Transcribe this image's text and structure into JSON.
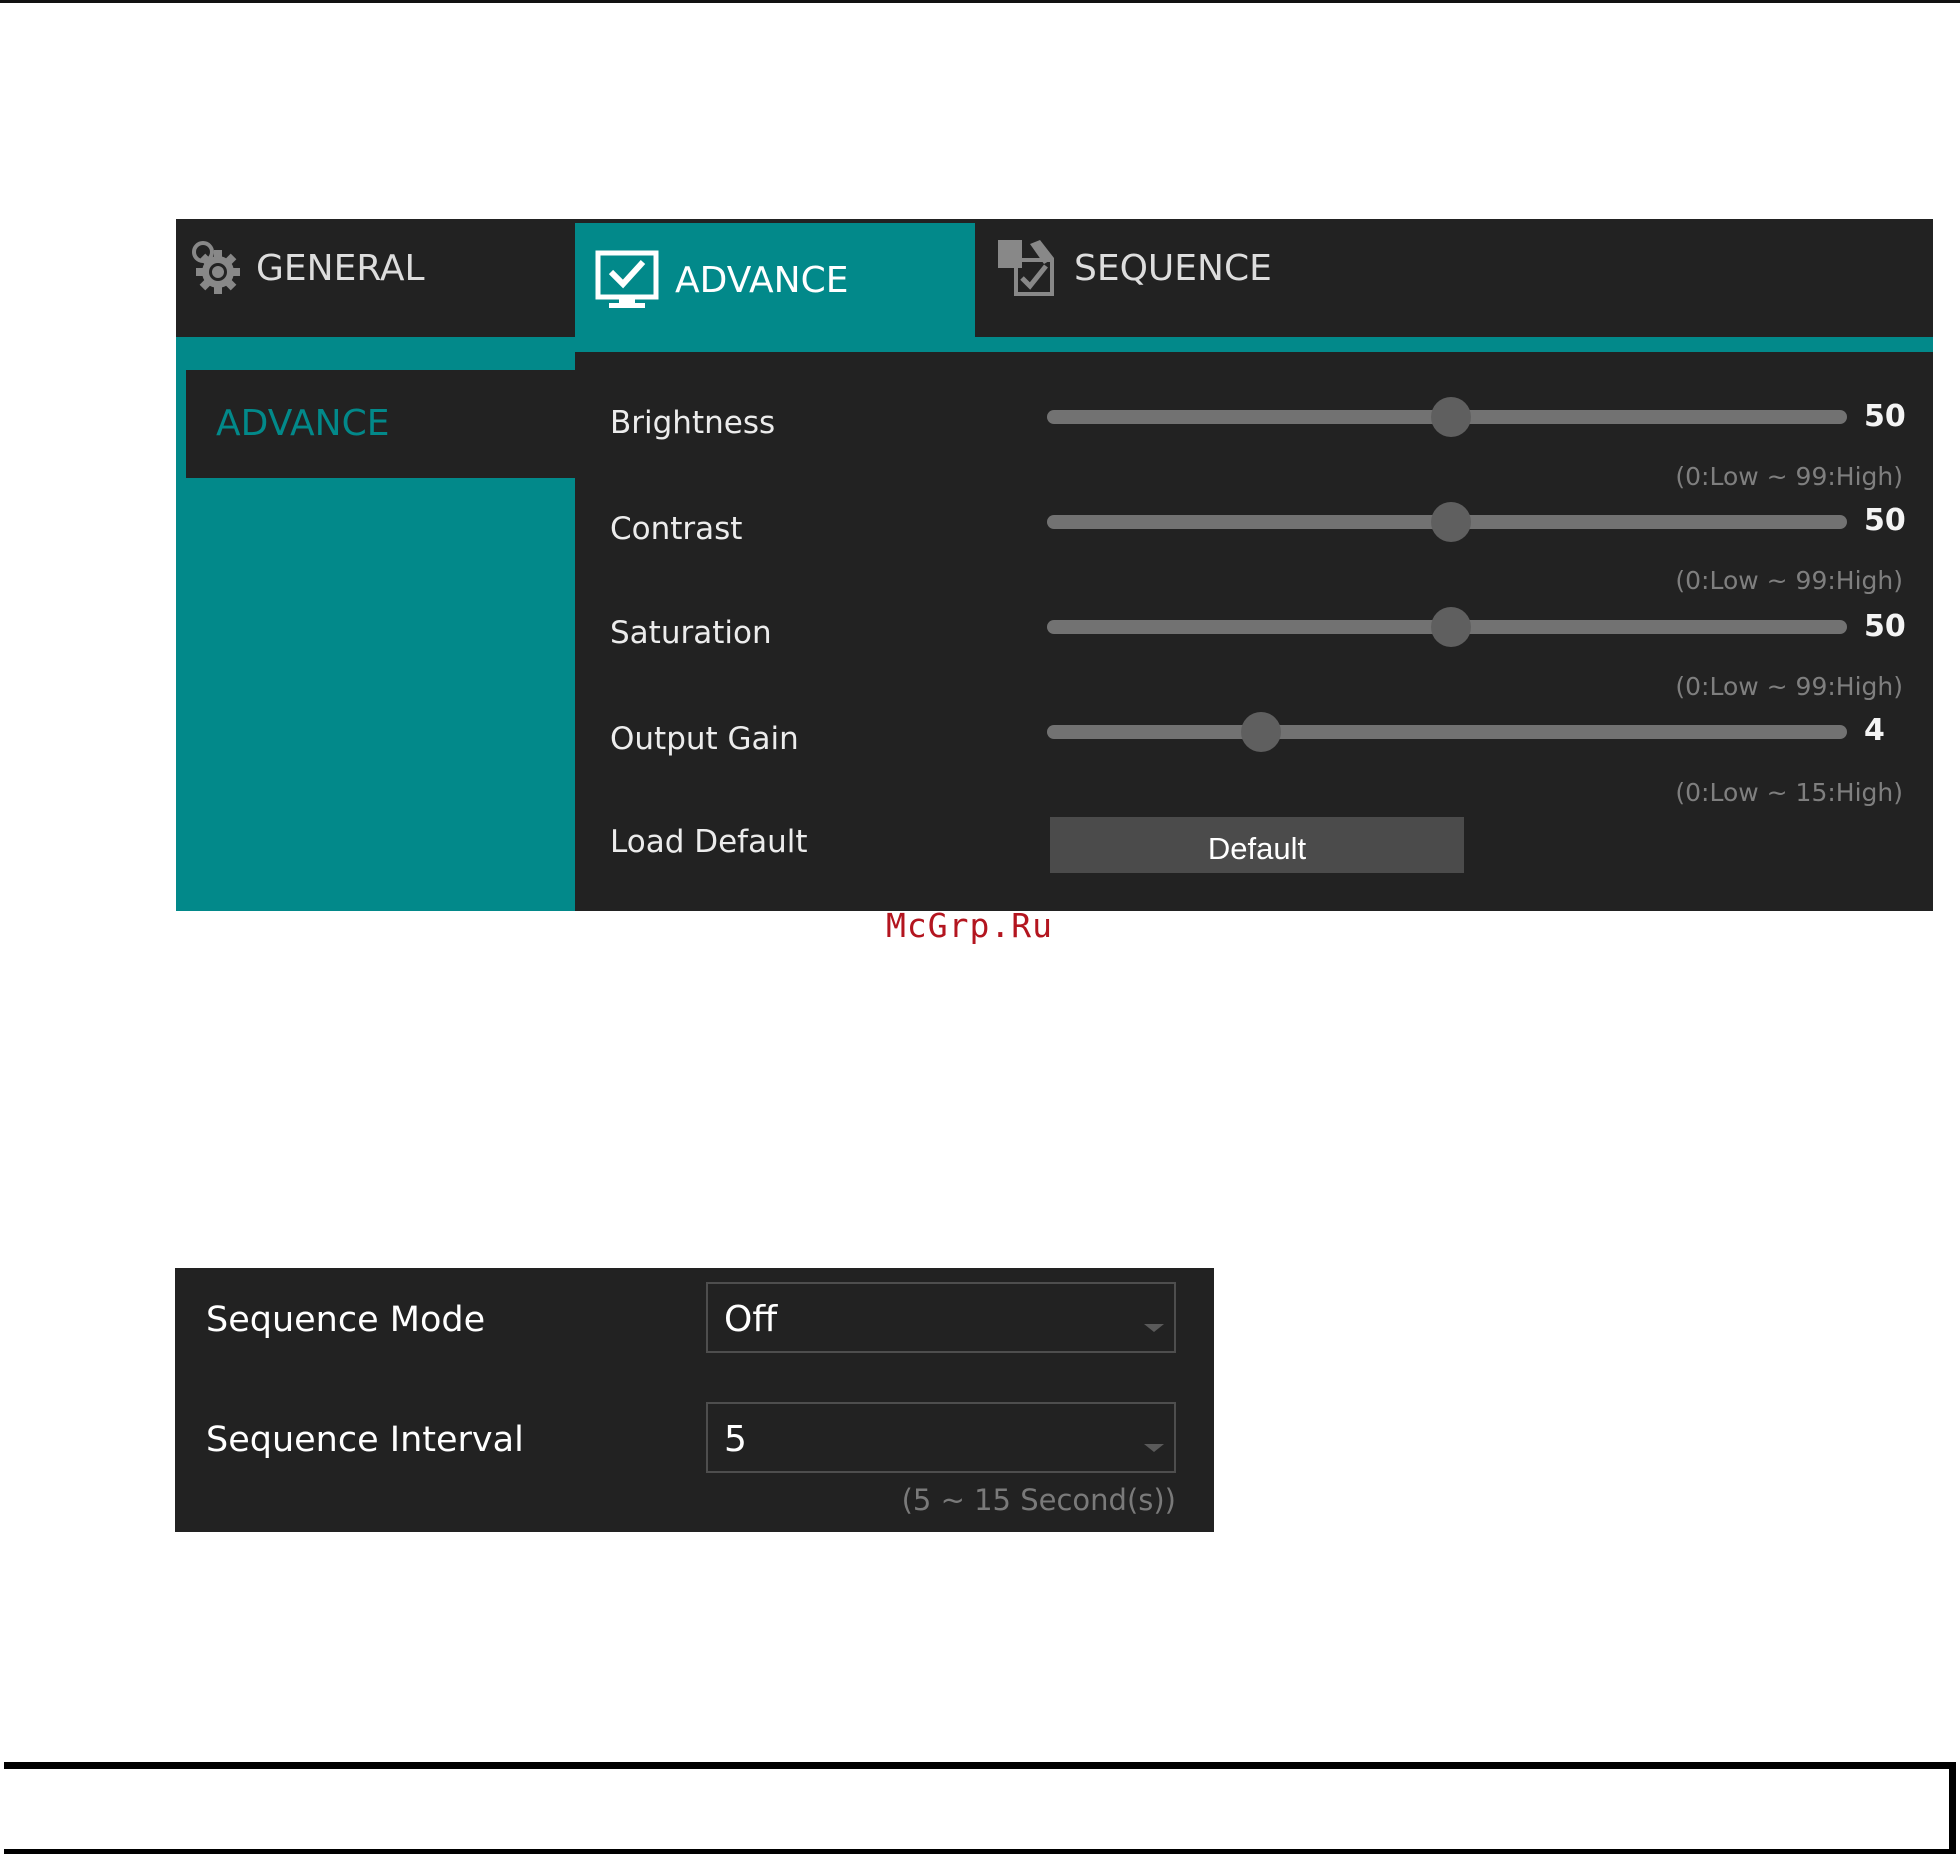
{
  "tabs": {
    "general": "GENERAL",
    "advance": "ADVANCE",
    "sequence": "SEQUENCE",
    "icons": {
      "general": "gear-icon",
      "advance": "monitor-check-icon",
      "sequence": "sequence-edit-icon"
    }
  },
  "sidebar": {
    "items": [
      {
        "label": "ADVANCE"
      }
    ]
  },
  "advance": {
    "rows": [
      {
        "label": "Brightness",
        "value": "50",
        "range": "(0:Low ~ 99:High)",
        "level": 0.505
      },
      {
        "label": "Contrast",
        "value": "50",
        "range": "(0:Low ~ 99:High)",
        "level": 0.505
      },
      {
        "label": "Saturation",
        "value": "50",
        "range": "(0:Low ~ 99:High)",
        "level": 0.505
      },
      {
        "label": "Output Gain",
        "value": "4",
        "range": "(0:Low ~ 15:High)",
        "level": 0.267
      }
    ],
    "load_default": {
      "label": "Load Default",
      "button": "Default"
    }
  },
  "watermark": "McGrp.Ru",
  "sequence": {
    "mode": {
      "label": "Sequence Mode",
      "value": "Off"
    },
    "interval": {
      "label": "Sequence Interval",
      "value": "5",
      "range": "(5 ~ 15 Second(s))"
    }
  },
  "colors": {
    "accent": "#02898a",
    "panel": "#222222",
    "watermark": "#b3151f"
  }
}
